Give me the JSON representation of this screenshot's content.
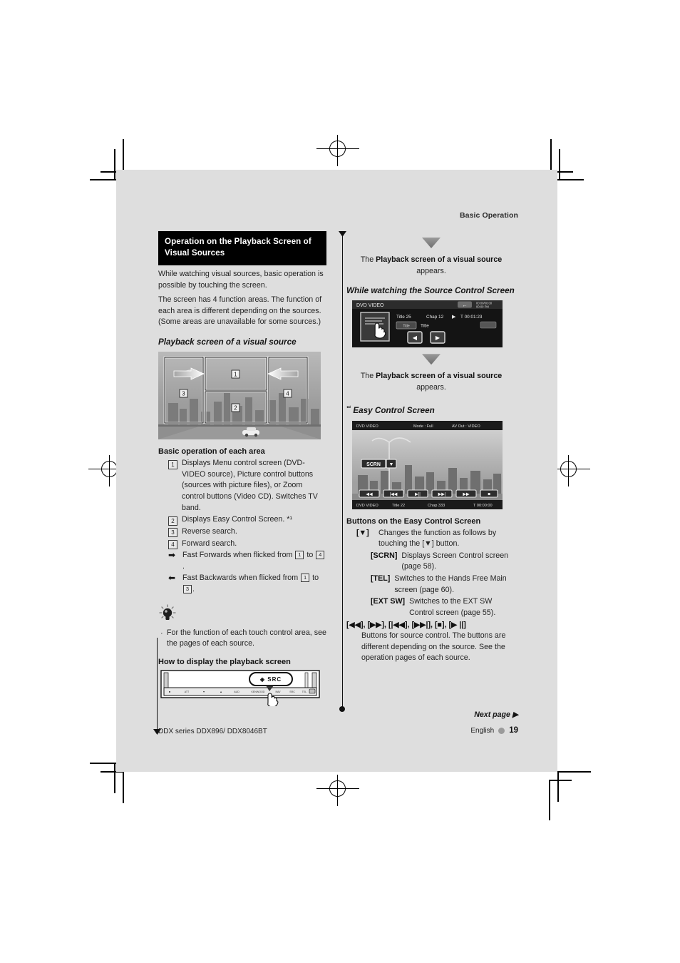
{
  "running_head": "Basic Operation",
  "left": {
    "section_title": "Operation on the Playback Screen of Visual Sources",
    "intro_1": "While watching visual sources, basic operation is possible by touching the screen.",
    "intro_2": "The screen has 4 function areas. The function of each area is different depending on the sources. (Some areas are unavailable for some sources.)",
    "figure_heading": "Playback screen of a visual source",
    "playback_figure": {
      "zones": [
        "1",
        "2",
        "3",
        "4"
      ],
      "arrow_left": "←",
      "arrow_right": "→"
    },
    "basic_op_heading": "Basic operation of each area",
    "items": [
      {
        "key": "1",
        "type": "num",
        "text": "Displays Menu control screen (DVD-VIDEO source), Picture control buttons (sources with picture files), or Zoom control buttons (Video CD). Switches TV band."
      },
      {
        "key": "2",
        "type": "num",
        "text": "Displays Easy Control Screen. *¹"
      },
      {
        "key": "3",
        "type": "num",
        "text": "Reverse search."
      },
      {
        "key": "4",
        "type": "num",
        "text": "Forward search."
      },
      {
        "key": "➡",
        "type": "sym",
        "text_a": "Fast Forwards when flicked from ",
        "ref_a": "1",
        "text_b": " to ",
        "ref_b": "4",
        "text_c": "."
      },
      {
        "key": "⬅",
        "type": "sym",
        "text_a": "Fast Backwards when flicked from ",
        "ref_a": "1",
        "text_b": " to ",
        "ref_b": "3",
        "text_c": "."
      }
    ],
    "tip_icon": "lightbulb-icon",
    "tip_bullet": "For the function of each touch control area, see the pages of each source.",
    "howto_heading": "How to display the playback screen",
    "faceplate": {
      "callout_label": "SRC",
      "brand": "KENWOOD",
      "keys": [
        "ATT",
        "▼",
        "▲",
        "AUD",
        "KENWOOD",
        "NAV",
        "SRC",
        "TEL",
        "●"
      ]
    }
  },
  "right": {
    "flow_1_caption_lead": "The ",
    "flow_1_caption_bold": "Playback screen of a visual source",
    "flow_1_caption_tail": "appears.",
    "while_watching_heading": "While watching the Source Control Screen",
    "source_control_screen": {
      "source": "DVD VIDEO",
      "time_top": "00:00/00:00",
      "clock": "00:00 PM",
      "title_label": "Title",
      "title_value": "25",
      "chap_label": "Chap",
      "chap_value": "12",
      "play_icon": "▶",
      "elapsed": "T 00:01:23",
      "btn_title": "Title",
      "btn_title2": "Title",
      "prev_icon": "◀",
      "next_icon": "▶"
    },
    "flow_2_caption_lead": "The ",
    "flow_2_caption_bold": "Playback screen of a visual source",
    "flow_2_caption_tail": "appears.",
    "easy_heading_mark": "*¹",
    "easy_heading": "Easy Control Screen",
    "easy_screen": {
      "source": "DVD VIDEO",
      "mode": "Mode : Full",
      "av_out": "AV Out : VIDEO",
      "scrn_label": "SCRN",
      "scrn_arrow": "▼",
      "buttons": [
        "◀◀",
        "|◀◀",
        "▶||",
        "▶▶|",
        "▶▶",
        "■"
      ],
      "status_source": "DVD VIDEO",
      "status_title": "Title 22",
      "status_chap": "Chap 333",
      "status_time": "T 00:00:00"
    },
    "buttons_heading": "Buttons on the Easy Control Screen",
    "button_items": [
      {
        "key": "[▼]",
        "text": "Changes the function as follows by touching the [▼] button."
      },
      {
        "key": "[SCRN]",
        "text": "Displays Screen Control screen (page 58).",
        "indent": 1
      },
      {
        "key": "[TEL]",
        "text": "Switches to the Hands Free Main screen (page 60).",
        "indent": 1
      },
      {
        "key": "[EXT SW]",
        "text": "Switches to the EXT SW Control screen (page 55).",
        "indent": 1
      },
      {
        "key": "[◀◀], [▶▶], [|◀◀], [▶▶|], [■], [▶ ||]",
        "text": "Buttons for source control. The buttons are different depending on the source. See the operation pages of each source.",
        "block": true
      }
    ]
  },
  "footer": {
    "next_page": "Next page ▶",
    "model": "DDX series   DDX896/ DDX8046BT",
    "language": "English",
    "page_number": "19"
  }
}
